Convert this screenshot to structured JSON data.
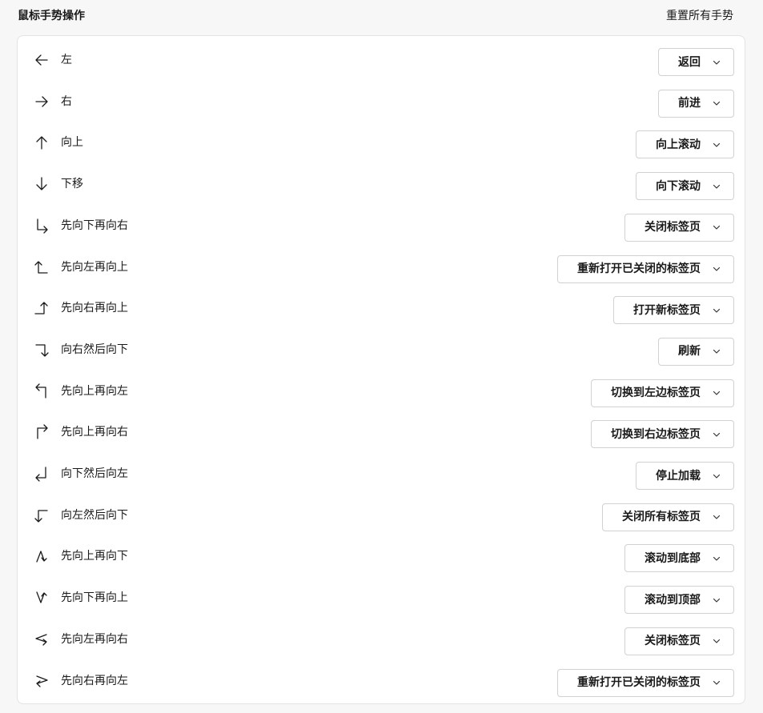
{
  "header": {
    "title": "鼠标手势操作",
    "reset_label": "重置所有手势"
  },
  "gestures": [
    {
      "icon": "arrow-left-icon",
      "label": "左",
      "action": "返回"
    },
    {
      "icon": "arrow-right-icon",
      "label": "右",
      "action": "前进"
    },
    {
      "icon": "arrow-up-icon",
      "label": "向上",
      "action": "向上滚动"
    },
    {
      "icon": "arrow-down-icon",
      "label": "下移",
      "action": "向下滚动"
    },
    {
      "icon": "down-then-right-icon",
      "label": "先向下再向右",
      "action": "关闭标签页"
    },
    {
      "icon": "left-then-up-icon",
      "label": "先向左再向上",
      "action": "重新打开已关闭的标签页"
    },
    {
      "icon": "right-then-up-icon",
      "label": "先向右再向上",
      "action": "打开新标签页"
    },
    {
      "icon": "right-then-down-icon",
      "label": "向右然后向下",
      "action": "刷新"
    },
    {
      "icon": "up-then-left-icon",
      "label": "先向上再向左",
      "action": "切换到左边标签页"
    },
    {
      "icon": "up-then-right-icon",
      "label": "先向上再向右",
      "action": "切换到右边标签页"
    },
    {
      "icon": "down-then-left-icon",
      "label": "向下然后向左",
      "action": "停止加载"
    },
    {
      "icon": "left-then-down-icon",
      "label": "向左然后向下",
      "action": "关闭所有标签页"
    },
    {
      "icon": "up-then-down-icon",
      "label": "先向上再向下",
      "action": "滚动到底部"
    },
    {
      "icon": "down-then-up-icon",
      "label": "先向下再向上",
      "action": "滚动到顶部"
    },
    {
      "icon": "left-then-right-icon",
      "label": "先向左再向右",
      "action": "关闭标签页"
    },
    {
      "icon": "right-then-left-icon",
      "label": "先向右再向左",
      "action": "重新打开已关闭的标签页"
    }
  ]
}
